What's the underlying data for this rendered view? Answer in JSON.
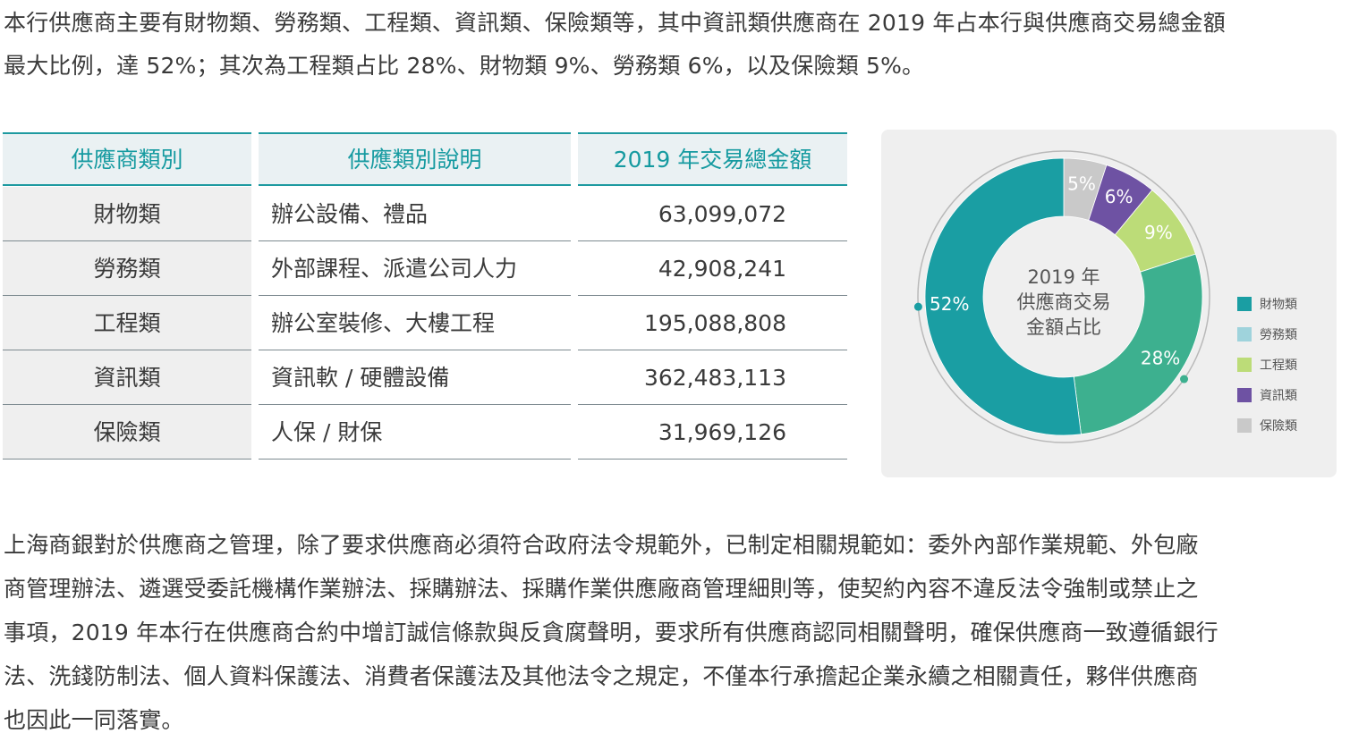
{
  "intro": {
    "line1": "本行供應商主要有財物類、勞務類、工程類、資訊類、保險類等，其中資訊類供應商在 2019 年占本行與供應商交易總金額",
    "line2": "最大比例，達 52%；其次為工程類占比 28%、財物類 9%、勞務類 6%，以及保險類 5%。"
  },
  "table": {
    "headers": [
      "供應商類別",
      "供應類別說明",
      "2019 年交易總金額"
    ],
    "rows": [
      {
        "category": "財物類",
        "description": "辦公設備、禮品",
        "amount": "63,099,072"
      },
      {
        "category": "勞務類",
        "description": "外部課程、派遣公司人力",
        "amount": "42,908,241"
      },
      {
        "category": "工程類",
        "description": "辦公室裝修、大樓工程",
        "amount": "195,088,808"
      },
      {
        "category": "資訊類",
        "description": "資訊軟 / 硬體設備",
        "amount": "362,483,113"
      },
      {
        "category": "保險類",
        "description": "人保 / 財保",
        "amount": "31,969,126"
      }
    ]
  },
  "chart": {
    "center_title": [
      "2019 年",
      "供應商交易",
      "金額占比"
    ],
    "legend": [
      {
        "label": "財物類",
        "color": "#1a9ea3"
      },
      {
        "label": "勞務類",
        "color": "#9fd3dc"
      },
      {
        "label": "工程類",
        "color": "#bcdc78"
      },
      {
        "label": "資訊類",
        "color": "#6e52a3"
      },
      {
        "label": "保險類",
        "color": "#c9c9c9"
      }
    ]
  },
  "chart_data": {
    "type": "pie",
    "slices": [
      {
        "label": "資訊類",
        "percent": 52,
        "value_label": "52%",
        "color": "#1a9ea3"
      },
      {
        "label": "工程類",
        "percent": 28,
        "value_label": "28%",
        "color": "#3db08f"
      },
      {
        "label": "財物類",
        "percent": 9,
        "value_label": "9%",
        "color": "#bcdc78"
      },
      {
        "label": "勞務類",
        "percent": 6,
        "value_label": "6%",
        "color": "#6e52a3"
      },
      {
        "label": "保險類",
        "percent": 5,
        "value_label": "5%",
        "color": "#c9c9c9"
      }
    ],
    "donut": true,
    "legend_position": "right"
  },
  "closing": {
    "lines": [
      "上海商銀對於供應商之管理，除了要求供應商必須符合政府法令規範外，已制定相關規範如：委外內部作業規範、外包廠",
      "商管理辦法、遴選受委託機構作業辦法、採購辦法、採購作業供應廠商管理細則等，使契約內容不違反法令強制或禁止之",
      "事項，2019 年本行在供應商合約中增訂誠信條款與反貪腐聲明，要求所有供應商認同相關聲明，確保供應商一致遵循銀行",
      "法、洗錢防制法、個人資料保護法、消費者保護法及其他法令之規定，不僅本行承擔起企業永續之相關責任，夥伴供應商",
      "也因此一同落實。"
    ]
  }
}
